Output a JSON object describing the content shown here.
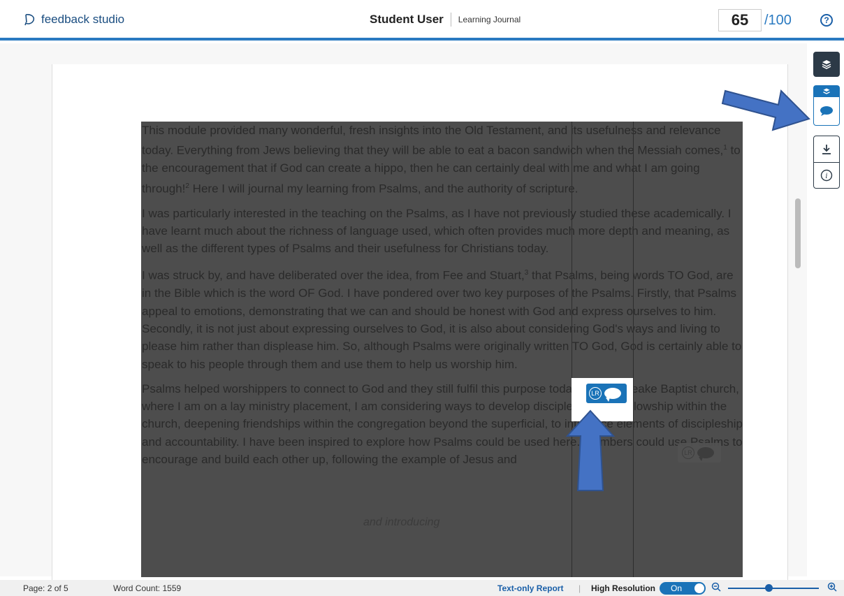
{
  "header": {
    "brand": "feedback studio",
    "student_name": "Student User",
    "assignment": "Learning Journal",
    "score": "65",
    "score_max": "/100",
    "help_label": "?"
  },
  "document": {
    "paragraphs": [
      {
        "text": "This module provided many wonderful, fresh insights into the Old Testament, and its usefulness and relevance today. Everything from Jews believing that they will be able to eat a bacon sandwich when the Messiah comes,",
        "sup": "1",
        "tail": " to the encouragement that if God can create a hippo, then he can certainly deal with me and what I am going through!",
        "sup2": "2",
        "tail2": " Here I will journal my learning from Psalms, and the authority of scripture."
      },
      {
        "text": "I was particularly interested in the teaching on the Psalms, as I have not previously studied these academically. I have learnt much about the richness of language used, which often provides much more depth and meaning, as well as the different types of Psalms and their usefulness for Christians today."
      },
      {
        "text": "I was struck by, and have deliberated over the idea, from Fee and Stuart,",
        "sup": "3",
        "tail": " that Psalms, being words TO God, are in the Bible which is the word OF God. I have pondered over two key purposes of the Psalms. Firstly, that Psalms appeal to emotions, demonstrating that we can and should be honest with God and express ourselves to him. Secondly, it is not just about expressing ourselves to God, it is also about considering God's ways and living to please him rather than displease him. So, although Psalms were originally written TO God, God is certainly able to speak to his people through them and use them to help us worship him."
      },
      {
        "text": "Psalms helped worshippers to connect to God and they still fulfil this purpose today. At East Leake Baptist church, where I am on a lay ministry placement, I am considering ways to develop discipleship and fellowship within the church, deepening friendships within the congregation beyond the superficial, to introduce elements of discipleship and accountability. I have been inspired to explore how Psalms could be used here. Members could use Psalms to encourage and build each other up, following the example of Jesus and"
      }
    ],
    "inline_comment": "and introducing",
    "mark_label": "LR"
  },
  "footer": {
    "page": "Page: 2 of 5",
    "word_count": "Word Count: 1559",
    "text_only_report": "Text-only Report",
    "separator": "|",
    "high_resolution": "High Resolution",
    "toggle_state": "On"
  },
  "colors": {
    "accent": "#1a73b8",
    "header_rule": "#2a7ac1",
    "rail_dark": "#2c3a47",
    "arrow": "#4472c4"
  },
  "icons": {
    "brand": "feedback-logo-icon",
    "help": "question-circle-icon",
    "layers": "layers-icon",
    "comment": "comment-bubble-icon",
    "download": "download-icon",
    "info": "info-icon",
    "zoom_out": "zoom-out-icon",
    "zoom_in": "zoom-in-icon"
  },
  "zoom_level": 0.42
}
